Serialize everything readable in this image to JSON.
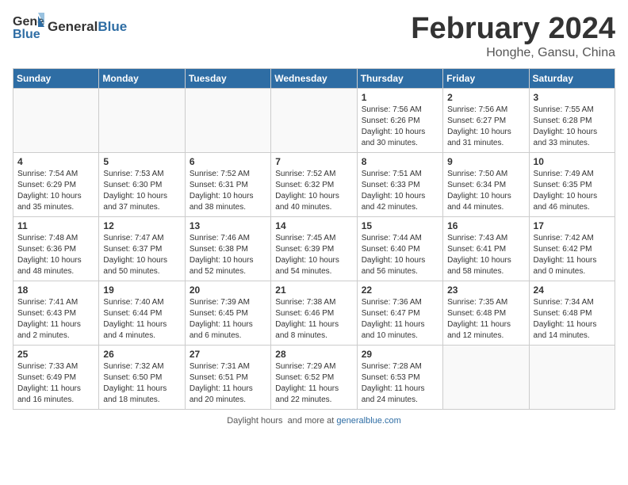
{
  "header": {
    "logo_general": "General",
    "logo_blue": "Blue",
    "title": "February 2024",
    "location": "Honghe, Gansu, China"
  },
  "calendar": {
    "days_of_week": [
      "Sunday",
      "Monday",
      "Tuesday",
      "Wednesday",
      "Thursday",
      "Friday",
      "Saturday"
    ],
    "weeks": [
      [
        {
          "day": "",
          "info": ""
        },
        {
          "day": "",
          "info": ""
        },
        {
          "day": "",
          "info": ""
        },
        {
          "day": "",
          "info": ""
        },
        {
          "day": "1",
          "info": "Sunrise: 7:56 AM\nSunset: 6:26 PM\nDaylight: 10 hours and 30 minutes."
        },
        {
          "day": "2",
          "info": "Sunrise: 7:56 AM\nSunset: 6:27 PM\nDaylight: 10 hours and 31 minutes."
        },
        {
          "day": "3",
          "info": "Sunrise: 7:55 AM\nSunset: 6:28 PM\nDaylight: 10 hours and 33 minutes."
        }
      ],
      [
        {
          "day": "4",
          "info": "Sunrise: 7:54 AM\nSunset: 6:29 PM\nDaylight: 10 hours and 35 minutes."
        },
        {
          "day": "5",
          "info": "Sunrise: 7:53 AM\nSunset: 6:30 PM\nDaylight: 10 hours and 37 minutes."
        },
        {
          "day": "6",
          "info": "Sunrise: 7:52 AM\nSunset: 6:31 PM\nDaylight: 10 hours and 38 minutes."
        },
        {
          "day": "7",
          "info": "Sunrise: 7:52 AM\nSunset: 6:32 PM\nDaylight: 10 hours and 40 minutes."
        },
        {
          "day": "8",
          "info": "Sunrise: 7:51 AM\nSunset: 6:33 PM\nDaylight: 10 hours and 42 minutes."
        },
        {
          "day": "9",
          "info": "Sunrise: 7:50 AM\nSunset: 6:34 PM\nDaylight: 10 hours and 44 minutes."
        },
        {
          "day": "10",
          "info": "Sunrise: 7:49 AM\nSunset: 6:35 PM\nDaylight: 10 hours and 46 minutes."
        }
      ],
      [
        {
          "day": "11",
          "info": "Sunrise: 7:48 AM\nSunset: 6:36 PM\nDaylight: 10 hours and 48 minutes."
        },
        {
          "day": "12",
          "info": "Sunrise: 7:47 AM\nSunset: 6:37 PM\nDaylight: 10 hours and 50 minutes."
        },
        {
          "day": "13",
          "info": "Sunrise: 7:46 AM\nSunset: 6:38 PM\nDaylight: 10 hours and 52 minutes."
        },
        {
          "day": "14",
          "info": "Sunrise: 7:45 AM\nSunset: 6:39 PM\nDaylight: 10 hours and 54 minutes."
        },
        {
          "day": "15",
          "info": "Sunrise: 7:44 AM\nSunset: 6:40 PM\nDaylight: 10 hours and 56 minutes."
        },
        {
          "day": "16",
          "info": "Sunrise: 7:43 AM\nSunset: 6:41 PM\nDaylight: 10 hours and 58 minutes."
        },
        {
          "day": "17",
          "info": "Sunrise: 7:42 AM\nSunset: 6:42 PM\nDaylight: 11 hours and 0 minutes."
        }
      ],
      [
        {
          "day": "18",
          "info": "Sunrise: 7:41 AM\nSunset: 6:43 PM\nDaylight: 11 hours and 2 minutes."
        },
        {
          "day": "19",
          "info": "Sunrise: 7:40 AM\nSunset: 6:44 PM\nDaylight: 11 hours and 4 minutes."
        },
        {
          "day": "20",
          "info": "Sunrise: 7:39 AM\nSunset: 6:45 PM\nDaylight: 11 hours and 6 minutes."
        },
        {
          "day": "21",
          "info": "Sunrise: 7:38 AM\nSunset: 6:46 PM\nDaylight: 11 hours and 8 minutes."
        },
        {
          "day": "22",
          "info": "Sunrise: 7:36 AM\nSunset: 6:47 PM\nDaylight: 11 hours and 10 minutes."
        },
        {
          "day": "23",
          "info": "Sunrise: 7:35 AM\nSunset: 6:48 PM\nDaylight: 11 hours and 12 minutes."
        },
        {
          "day": "24",
          "info": "Sunrise: 7:34 AM\nSunset: 6:48 PM\nDaylight: 11 hours and 14 minutes."
        }
      ],
      [
        {
          "day": "25",
          "info": "Sunrise: 7:33 AM\nSunset: 6:49 PM\nDaylight: 11 hours and 16 minutes."
        },
        {
          "day": "26",
          "info": "Sunrise: 7:32 AM\nSunset: 6:50 PM\nDaylight: 11 hours and 18 minutes."
        },
        {
          "day": "27",
          "info": "Sunrise: 7:31 AM\nSunset: 6:51 PM\nDaylight: 11 hours and 20 minutes."
        },
        {
          "day": "28",
          "info": "Sunrise: 7:29 AM\nSunset: 6:52 PM\nDaylight: 11 hours and 22 minutes."
        },
        {
          "day": "29",
          "info": "Sunrise: 7:28 AM\nSunset: 6:53 PM\nDaylight: 11 hours and 24 minutes."
        },
        {
          "day": "",
          "info": ""
        },
        {
          "day": "",
          "info": ""
        }
      ]
    ]
  },
  "footer": {
    "text": "Daylight hours",
    "link": "https://www.generalblue.com"
  }
}
